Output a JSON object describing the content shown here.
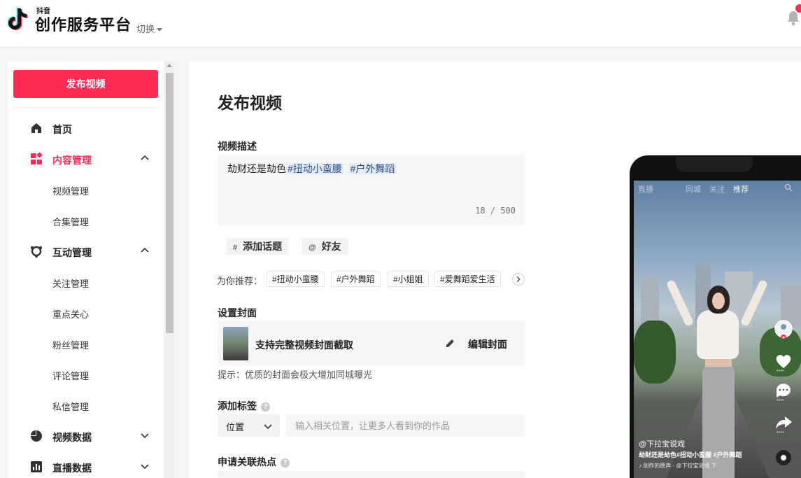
{
  "header": {
    "brand_small": "抖音",
    "brand": "创作服务平台",
    "switch_label": "切换"
  },
  "sidebar": {
    "publish_label": "发布视频",
    "items": [
      {
        "label": "首页"
      },
      {
        "label": "内容管理",
        "subs": [
          "视频管理",
          "合集管理"
        ]
      },
      {
        "label": "互动管理",
        "subs": [
          "关注管理",
          "重点关心",
          "粉丝管理",
          "评论管理",
          "私信管理"
        ]
      },
      {
        "label": "视频数据"
      },
      {
        "label": "直播数据"
      }
    ]
  },
  "main": {
    "title": "发布视频",
    "desc_label": "视频描述",
    "desc_text": "劫财还是劫色",
    "desc_tag1": "#扭动小蛮腰",
    "desc_tag2": "#户外舞蹈",
    "desc_count": "18 / 500",
    "topic_symbol": "#",
    "topic_label": "添加话题",
    "friend_symbol": "@",
    "friend_label": "好友",
    "rec_label": "为你推荐：",
    "rec_tags": [
      "#扭动小蛮腰",
      "#户外舞蹈",
      "#小姐姐",
      "#爱舞蹈爱生活"
    ],
    "cover_label": "设置封面",
    "cover_text": "支持完整视频封面截取",
    "edit_cover_label": "编辑封面",
    "hint": "提示：优质的封面会极大增加同城曝光",
    "tag_label": "添加标签",
    "location_select": "位置",
    "location_placeholder": "输入相关位置，让更多人看到你的作品",
    "hot_label": "申请关联热点"
  },
  "preview": {
    "top_tabs": [
      "直播",
      "同城",
      "关注",
      "推荐"
    ],
    "username": "@下拉宝说戏",
    "caption": "劫财还是劫色#扭动小蛮腰 #户外舞蹈",
    "music": "创作的原声 - @下拉宝说戏 下",
    "counts": [
      "****",
      "****",
      "****"
    ]
  },
  "colors": {
    "accent": "#fe2c55"
  }
}
